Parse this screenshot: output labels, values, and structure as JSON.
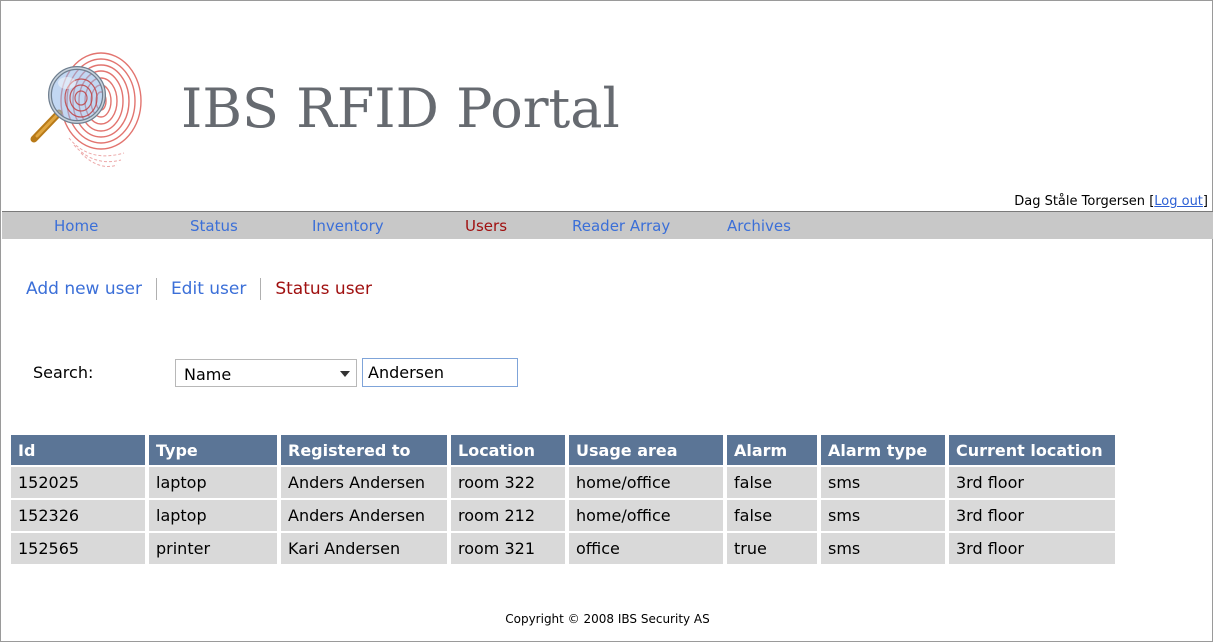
{
  "header": {
    "site_title": "IBS RFID Portal",
    "user_name": "Dag Ståle Torgersen",
    "logout_label": "Log out"
  },
  "nav": {
    "items": [
      {
        "label": "Home"
      },
      {
        "label": "Status"
      },
      {
        "label": "Inventory"
      },
      {
        "label": "Users",
        "active": true
      },
      {
        "label": "Reader Array"
      },
      {
        "label": "Archives"
      }
    ]
  },
  "subnav": {
    "items": [
      {
        "label": "Add new user"
      },
      {
        "label": "Edit user"
      },
      {
        "label": "Status user",
        "active": true
      }
    ]
  },
  "search": {
    "label": "Search:",
    "field_selected": "Name",
    "query_value": "Andersen"
  },
  "table": {
    "columns": [
      "Id",
      "Type",
      "Registered to",
      "Location",
      "Usage area",
      "Alarm",
      "Alarm type",
      "Current location"
    ],
    "rows": [
      [
        "152025",
        "laptop",
        "Anders Andersen",
        "room 322",
        "home/office",
        "false",
        "sms",
        "3rd floor"
      ],
      [
        "152326",
        "laptop",
        "Anders Andersen",
        "room 212",
        "home/office",
        "false",
        "sms",
        "3rd floor"
      ],
      [
        "152565",
        "printer",
        "Kari Andersen",
        "room 321",
        "office",
        "true",
        "sms",
        "3rd floor"
      ]
    ]
  },
  "footer": {
    "copyright": "Copyright © 2008 IBS Security AS"
  },
  "colors": {
    "nav_link": "#3b6fd8",
    "active_link": "#a01010",
    "table_header": "#5b7596",
    "table_cell": "#d9d9d9",
    "navbar_bg": "#c8c8c8"
  },
  "icons": {
    "logo": "fingerprint-magnifier-icon"
  }
}
